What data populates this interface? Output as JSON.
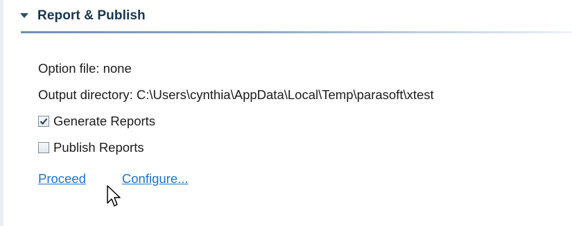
{
  "section": {
    "title": "Report & Publish",
    "expanded": true,
    "icon": "triangle-down-icon"
  },
  "fields": {
    "option_file": "Option file: none",
    "output_directory": "Output directory: C:\\Users\\cynthia\\AppData\\Local\\Temp\\parasoft\\xtest"
  },
  "checkboxes": [
    {
      "label": "Generate Reports",
      "checked": true
    },
    {
      "label": "Publish Reports",
      "checked": false
    }
  ],
  "links": {
    "proceed": "Proceed",
    "configure": "Configure..."
  },
  "colors": {
    "section_title": "#19344f",
    "link": "#1a73c9",
    "header_rule": "#6f8fb3"
  }
}
